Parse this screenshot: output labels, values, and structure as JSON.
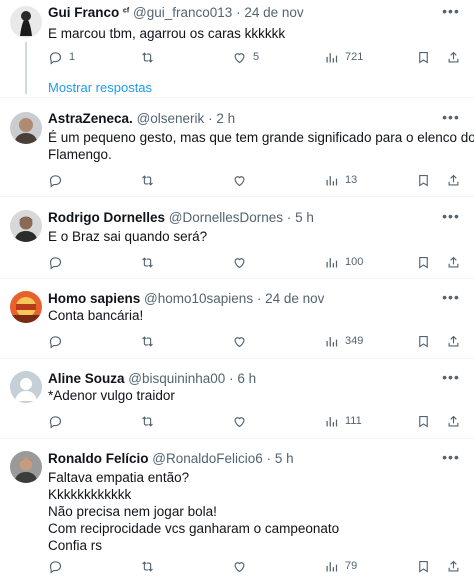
{
  "posts": [
    {
      "name": "Gui Franco",
      "name_suffix": "ᶜᶠ",
      "handle": "@gui_franco013",
      "sep": "·",
      "time": "24 de nov",
      "lines": [
        "E marcou tbm, agarrou os caras kkkkkk"
      ],
      "reply_count": "1",
      "retweet_count": "",
      "like_count": "5",
      "view_count": "721",
      "avatar_colors": [
        "#1b1b1b",
        "#ffffff"
      ]
    },
    {
      "name": "AstraZeneca.",
      "handle": "@olsenerik",
      "sep": "·",
      "time": "2 h",
      "lines": [
        "É um pequeno gesto, mas que tem grande significado para o elenco do",
        "Flamengo."
      ],
      "reply_count": "",
      "retweet_count": "",
      "like_count": "",
      "view_count": "13",
      "avatar_colors": [
        "#c9cdd1",
        "#6b5a4c"
      ]
    },
    {
      "name": "Rodrigo Dornelles",
      "handle": "@DornellesDornes",
      "sep": "·",
      "time": "5 h",
      "lines": [
        "E o Braz sai quando será?"
      ],
      "reply_count": "",
      "retweet_count": "",
      "like_count": "",
      "view_count": "100",
      "avatar_colors": [
        "#d8d8d8",
        "#2b2b2b"
      ]
    },
    {
      "name": "Homo sapiens",
      "handle": "@homo10sapiens",
      "sep": "·",
      "time": "24 de nov",
      "lines": [
        "Conta bancária!"
      ],
      "reply_count": "",
      "retweet_count": "",
      "like_count": "",
      "view_count": "349",
      "avatar_colors": [
        "#e8602c",
        "#f6c65b"
      ]
    },
    {
      "name": "Aline Souza",
      "handle": "@bisquininha00",
      "sep": "·",
      "time": "6 h",
      "lines": [
        "*Adenor vulgo traidor"
      ],
      "reply_count": "",
      "retweet_count": "",
      "like_count": "",
      "view_count": "111",
      "avatar_colors": [
        "#c4cfd6",
        "#ffffff"
      ]
    },
    {
      "name": "Ronaldo Felício",
      "handle": "@RonaldoFelicio6",
      "sep": "·",
      "time": "5 h",
      "lines": [
        "Faltava empatia então?",
        "Kkkkkkkkkkkk",
        "Não precisa nem jogar bola!",
        "Com reciprocidade vcs ganharam o campeonato",
        "Confia rs"
      ],
      "reply_count": "",
      "retweet_count": "",
      "like_count": "",
      "view_count": "79",
      "avatar_colors": [
        "#9a9a9a",
        "#3c3c3c"
      ]
    }
  ],
  "show_replies_label": "Mostrar respostas",
  "colors": {
    "text": "#0f1419",
    "secondary": "#536471",
    "link": "#1d9bf0",
    "divider": "#eff3f4",
    "thread_line": "#cfd9de"
  },
  "icons": [
    "reply-icon",
    "retweet-icon",
    "like-icon",
    "views-icon",
    "bookmark-icon",
    "share-icon",
    "more-icon"
  ]
}
